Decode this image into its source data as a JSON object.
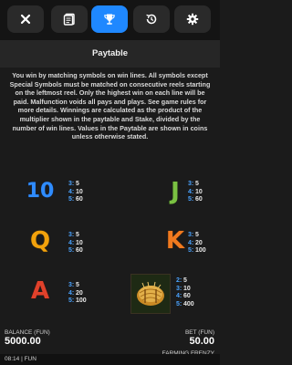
{
  "toolbar": {
    "buttons": [
      {
        "icon": "close-icon"
      },
      {
        "icon": "paytable-icon"
      },
      {
        "icon": "trophy-icon",
        "active": true
      },
      {
        "icon": "history-icon"
      },
      {
        "icon": "gear-icon"
      }
    ],
    "accent": "#1f88ff"
  },
  "page": {
    "title": "Paytable",
    "description": "You win by matching symbols on win lines. All symbols except Special Symbols must be matched on consecutive reels starting on the leftmost reel. Only the highest win on each line will be paid. Malfunction voids all pays and plays. See game rules for more details. Winnings are calculated as the product of the multiplier shown in the paytable and Stake, divided by the number of win lines. Values in the Paytable are shown in coins unless otherwise stated."
  },
  "paytable": [
    {
      "symbol": "10",
      "color": "#2f8cff",
      "pays": [
        {
          "k": "3:",
          "v": "5"
        },
        {
          "k": "4:",
          "v": "10"
        },
        {
          "k": "5:",
          "v": "60"
        }
      ]
    },
    {
      "symbol": "J",
      "color": "#7ac142",
      "pays": [
        {
          "k": "3:",
          "v": "5"
        },
        {
          "k": "4:",
          "v": "10"
        },
        {
          "k": "5:",
          "v": "60"
        }
      ]
    },
    {
      "symbol": "Q",
      "color": "#f2a20c",
      "pays": [
        {
          "k": "3:",
          "v": "5"
        },
        {
          "k": "4:",
          "v": "10"
        },
        {
          "k": "5:",
          "v": "60"
        }
      ]
    },
    {
      "symbol": "K",
      "color": "#f07a1f",
      "pays": [
        {
          "k": "3:",
          "v": "5"
        },
        {
          "k": "4:",
          "v": "20"
        },
        {
          "k": "5:",
          "v": "100"
        }
      ]
    },
    {
      "symbol": "A",
      "color": "#e0412b",
      "pays": [
        {
          "k": "3:",
          "v": "5"
        },
        {
          "k": "4:",
          "v": "20"
        },
        {
          "k": "5:",
          "v": "100"
        }
      ]
    },
    {
      "symbol": "hay-bale",
      "color": "#d9a43a",
      "pays": [
        {
          "k": "2:",
          "v": "5"
        },
        {
          "k": "3:",
          "v": "10"
        },
        {
          "k": "4:",
          "v": "60"
        },
        {
          "k": "5:",
          "v": "400"
        }
      ]
    }
  ],
  "status": {
    "balance_label": "BALANCE (FUN)",
    "balance_value": "5000.00",
    "bet_label": "BET (FUN)",
    "bet_value": "50.00",
    "game_name": "FARMING FRENZY",
    "clock": "08:14 | FUN"
  }
}
